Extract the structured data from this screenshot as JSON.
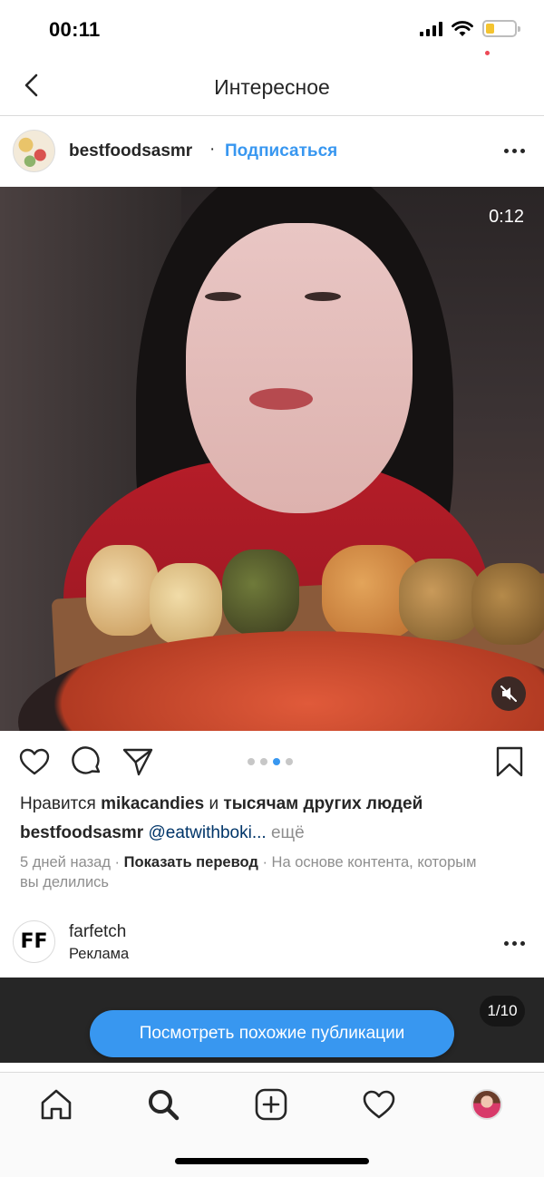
{
  "status_bar": {
    "time": "00:11",
    "battery_level": 0.3
  },
  "nav": {
    "title": "Интересное",
    "back_icon": "chevron-left-icon"
  },
  "post": {
    "username": "bestfoodsasmr",
    "separator": "·",
    "follow_label": "Подписаться",
    "video_time": "0:12",
    "carousel": {
      "count": 4,
      "active": 3
    },
    "likes": {
      "prefix": "Нравится",
      "user": "mikacandies",
      "joiner": "и",
      "others": "тысячам других людей"
    },
    "caption": {
      "username": "bestfoodsasmr",
      "mention": "@eatwithboki...",
      "more": "ещё"
    },
    "meta": {
      "time_ago": "5 дней назад",
      "dot": "·",
      "show_translation": "Показать перевод",
      "reason": "На основе контента, которым вы делились"
    }
  },
  "ad": {
    "name": "farfetch",
    "label": "Реклама",
    "logo_text": "FF",
    "counter": "1/10"
  },
  "similar_button": "Посмотреть похожие публикации",
  "tabbar": {
    "items": [
      "home-icon",
      "search-icon",
      "add-icon",
      "heart-icon",
      "profile-avatar"
    ]
  },
  "colors": {
    "accent": "#3897f0",
    "text": "#262626",
    "muted": "#8e8e8e",
    "notification": "#ed4956"
  }
}
